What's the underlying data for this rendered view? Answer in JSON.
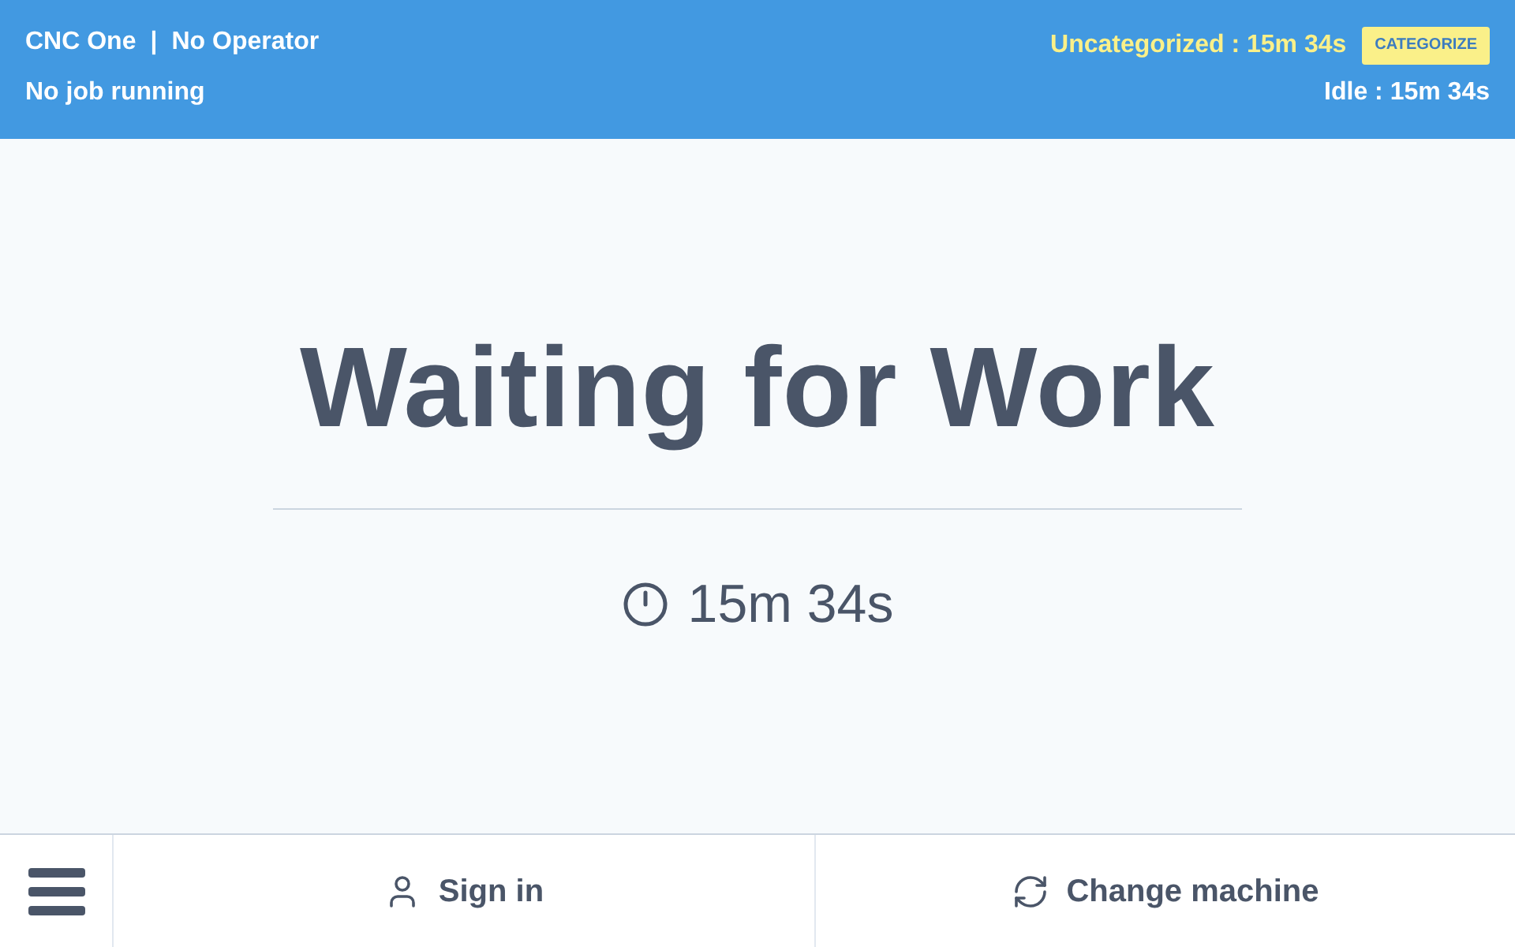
{
  "header": {
    "machine": "CNC One",
    "separator": "|",
    "operator": "No Operator",
    "job": "No job running",
    "category_status": "Uncategorized : 15m 34s",
    "categorize_button": "CATEGORIZE",
    "state_duration": "Idle : 15m 34s"
  },
  "main": {
    "title": "Waiting for Work",
    "elapsed": "15m 34s"
  },
  "footer": {
    "buttons": [
      {
        "kind": "menu"
      },
      {
        "kind": "sign-in",
        "label": "Sign in"
      },
      {
        "kind": "change-machine",
        "label": "Change machine"
      }
    ]
  }
}
